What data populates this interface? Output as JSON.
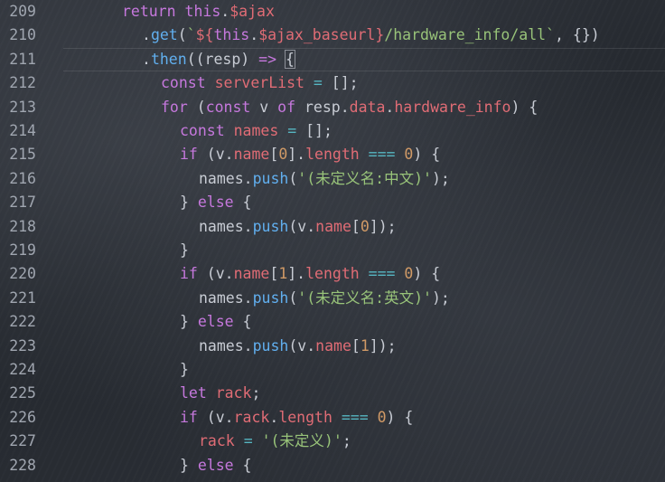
{
  "editor": {
    "lines": [
      {
        "number": "209",
        "indent": 135,
        "tokens": [
          {
            "t": "return ",
            "c": "kw"
          },
          {
            "t": "this",
            "c": "th"
          },
          {
            "t": ".",
            "c": "pl"
          },
          {
            "t": "$ajax",
            "c": "var"
          }
        ]
      },
      {
        "number": "210",
        "indent": 157,
        "tokens": [
          {
            "t": ".",
            "c": "pl"
          },
          {
            "t": "get",
            "c": "fn"
          },
          {
            "t": "(",
            "c": "pl"
          },
          {
            "t": "`",
            "c": "str"
          },
          {
            "t": "${",
            "c": "tmpl"
          },
          {
            "t": "this",
            "c": "th"
          },
          {
            "t": ".",
            "c": "pl"
          },
          {
            "t": "$ajax_baseurl",
            "c": "var"
          },
          {
            "t": "}",
            "c": "tmpl"
          },
          {
            "t": "/hardware_info/all`",
            "c": "str"
          },
          {
            "t": ", {})",
            "c": "pl"
          }
        ]
      },
      {
        "number": "211",
        "indent": 157,
        "active": true,
        "tokens": [
          {
            "t": ".",
            "c": "pl"
          },
          {
            "t": "then",
            "c": "fn"
          },
          {
            "t": "((resp) ",
            "c": "pl"
          },
          {
            "t": "=>",
            "c": "kw"
          },
          {
            "t": " ",
            "c": "pl"
          },
          {
            "t": "{",
            "c": "pl cursor-brace"
          }
        ]
      },
      {
        "number": "212",
        "indent": 178,
        "tokens": [
          {
            "t": "const ",
            "c": "kw"
          },
          {
            "t": "serverList",
            "c": "var"
          },
          {
            "t": " ",
            "c": "pl"
          },
          {
            "t": "=",
            "c": "op"
          },
          {
            "t": " [];",
            "c": "pl"
          }
        ]
      },
      {
        "number": "213",
        "indent": 178,
        "tokens": [
          {
            "t": "for",
            "c": "kw"
          },
          {
            "t": " (",
            "c": "pl"
          },
          {
            "t": "const ",
            "c": "kw"
          },
          {
            "t": "v ",
            "c": "pl"
          },
          {
            "t": "of",
            "c": "kw"
          },
          {
            "t": " resp.",
            "c": "pl"
          },
          {
            "t": "data",
            "c": "prop"
          },
          {
            "t": ".",
            "c": "pl"
          },
          {
            "t": "hardware_info",
            "c": "prop"
          },
          {
            "t": ") {",
            "c": "pl"
          }
        ]
      },
      {
        "number": "214",
        "indent": 199,
        "tokens": [
          {
            "t": "const ",
            "c": "kw"
          },
          {
            "t": "names",
            "c": "var"
          },
          {
            "t": " ",
            "c": "pl"
          },
          {
            "t": "=",
            "c": "op"
          },
          {
            "t": " [];",
            "c": "pl"
          }
        ]
      },
      {
        "number": "215",
        "indent": 199,
        "tokens": [
          {
            "t": "if",
            "c": "kw"
          },
          {
            "t": " (v.",
            "c": "pl"
          },
          {
            "t": "name",
            "c": "prop"
          },
          {
            "t": "[",
            "c": "pl"
          },
          {
            "t": "0",
            "c": "num"
          },
          {
            "t": "].",
            "c": "pl"
          },
          {
            "t": "length",
            "c": "prop"
          },
          {
            "t": " ",
            "c": "pl"
          },
          {
            "t": "===",
            "c": "op"
          },
          {
            "t": " ",
            "c": "pl"
          },
          {
            "t": "0",
            "c": "num"
          },
          {
            "t": ") {",
            "c": "pl"
          }
        ]
      },
      {
        "number": "216",
        "indent": 220,
        "tokens": [
          {
            "t": "names.",
            "c": "pl"
          },
          {
            "t": "push",
            "c": "fn"
          },
          {
            "t": "(",
            "c": "pl"
          },
          {
            "t": "'(未定义名:中文)'",
            "c": "str"
          },
          {
            "t": ");",
            "c": "pl"
          }
        ]
      },
      {
        "number": "217",
        "indent": 199,
        "tokens": [
          {
            "t": "} ",
            "c": "pl"
          },
          {
            "t": "else",
            "c": "kw"
          },
          {
            "t": " {",
            "c": "pl"
          }
        ]
      },
      {
        "number": "218",
        "indent": 220,
        "tokens": [
          {
            "t": "names.",
            "c": "pl"
          },
          {
            "t": "push",
            "c": "fn"
          },
          {
            "t": "(v.",
            "c": "pl"
          },
          {
            "t": "name",
            "c": "prop"
          },
          {
            "t": "[",
            "c": "pl"
          },
          {
            "t": "0",
            "c": "num"
          },
          {
            "t": "]);",
            "c": "pl"
          }
        ]
      },
      {
        "number": "219",
        "indent": 199,
        "tokens": [
          {
            "t": "}",
            "c": "pl"
          }
        ]
      },
      {
        "number": "220",
        "indent": 199,
        "tokens": [
          {
            "t": "if",
            "c": "kw"
          },
          {
            "t": " (v.",
            "c": "pl"
          },
          {
            "t": "name",
            "c": "prop"
          },
          {
            "t": "[",
            "c": "pl"
          },
          {
            "t": "1",
            "c": "num"
          },
          {
            "t": "].",
            "c": "pl"
          },
          {
            "t": "length",
            "c": "prop"
          },
          {
            "t": " ",
            "c": "pl"
          },
          {
            "t": "===",
            "c": "op"
          },
          {
            "t": " ",
            "c": "pl"
          },
          {
            "t": "0",
            "c": "num"
          },
          {
            "t": ") {",
            "c": "pl"
          }
        ]
      },
      {
        "number": "221",
        "indent": 220,
        "tokens": [
          {
            "t": "names.",
            "c": "pl"
          },
          {
            "t": "push",
            "c": "fn"
          },
          {
            "t": "(",
            "c": "pl"
          },
          {
            "t": "'(未定义名:英文)'",
            "c": "str"
          },
          {
            "t": ");",
            "c": "pl"
          }
        ]
      },
      {
        "number": "222",
        "indent": 199,
        "tokens": [
          {
            "t": "} ",
            "c": "pl"
          },
          {
            "t": "else",
            "c": "kw"
          },
          {
            "t": " {",
            "c": "pl"
          }
        ]
      },
      {
        "number": "223",
        "indent": 220,
        "tokens": [
          {
            "t": "names.",
            "c": "pl"
          },
          {
            "t": "push",
            "c": "fn"
          },
          {
            "t": "(v.",
            "c": "pl"
          },
          {
            "t": "name",
            "c": "prop"
          },
          {
            "t": "[",
            "c": "pl"
          },
          {
            "t": "1",
            "c": "num"
          },
          {
            "t": "]);",
            "c": "pl"
          }
        ]
      },
      {
        "number": "224",
        "indent": 199,
        "tokens": [
          {
            "t": "}",
            "c": "pl"
          }
        ]
      },
      {
        "number": "225",
        "indent": 199,
        "tokens": [
          {
            "t": "let ",
            "c": "kw"
          },
          {
            "t": "rack",
            "c": "var"
          },
          {
            "t": ";",
            "c": "pl"
          }
        ]
      },
      {
        "number": "226",
        "indent": 199,
        "tokens": [
          {
            "t": "if",
            "c": "kw"
          },
          {
            "t": " (v.",
            "c": "pl"
          },
          {
            "t": "rack",
            "c": "prop"
          },
          {
            "t": ".",
            "c": "pl"
          },
          {
            "t": "length",
            "c": "prop"
          },
          {
            "t": " ",
            "c": "pl"
          },
          {
            "t": "===",
            "c": "op"
          },
          {
            "t": " ",
            "c": "pl"
          },
          {
            "t": "0",
            "c": "num"
          },
          {
            "t": ") {",
            "c": "pl"
          }
        ]
      },
      {
        "number": "227",
        "indent": 220,
        "tokens": [
          {
            "t": "rack",
            "c": "var"
          },
          {
            "t": " ",
            "c": "pl"
          },
          {
            "t": "=",
            "c": "op"
          },
          {
            "t": " ",
            "c": "pl"
          },
          {
            "t": "'(未定义)'",
            "c": "str"
          },
          {
            "t": ";",
            "c": "pl"
          }
        ]
      },
      {
        "number": "228",
        "indent": 199,
        "tokens": [
          {
            "t": "} ",
            "c": "pl"
          },
          {
            "t": "else",
            "c": "kw"
          },
          {
            "t": " {",
            "c": "pl"
          }
        ]
      }
    ]
  }
}
